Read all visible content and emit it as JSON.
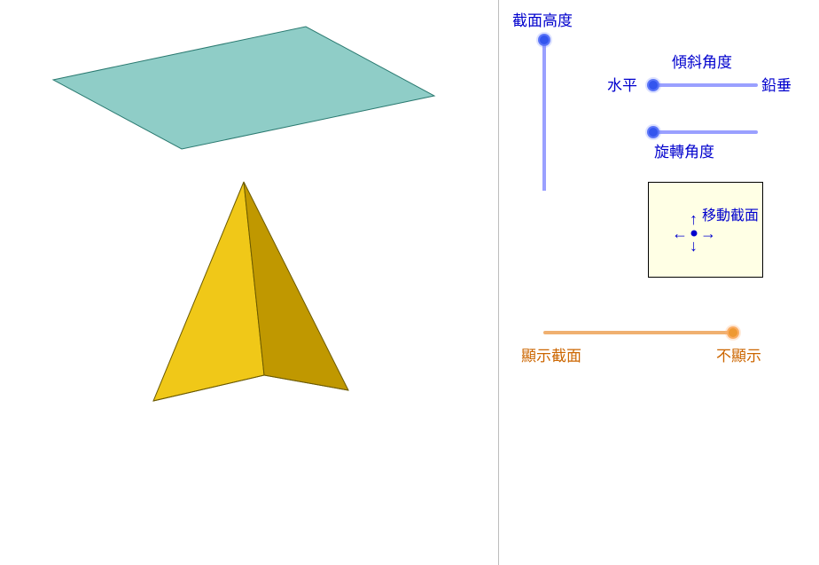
{
  "sliders": {
    "section_height": {
      "label": "截面高度"
    },
    "tilt_angle": {
      "label": "傾斜角度",
      "left": "水平",
      "right": "鉛垂"
    },
    "rotation_angle": {
      "label": "旋轉角度"
    }
  },
  "move_panel": {
    "label": "移動截面"
  },
  "display_toggle": {
    "left": "顯示截面",
    "right": "不顯示"
  },
  "chart_data": {
    "type": "diagram",
    "title": "Pyramid cross-section interactive",
    "objects": [
      {
        "name": "pyramid",
        "shape": "square_pyramid",
        "faces_visible": 2,
        "color": "#e0b800"
      },
      {
        "name": "cutting_plane",
        "shape": "quadrilateral",
        "color": "#7cc8c2",
        "position": "above_apex"
      }
    ],
    "controls": {
      "section_height": {
        "type": "vertical_slider",
        "value_position": "top"
      },
      "tilt_angle": {
        "type": "horizontal_slider",
        "value_position": "left",
        "endpoints": [
          "水平",
          "鉛垂"
        ]
      },
      "rotation_angle": {
        "type": "horizontal_slider",
        "value_position": "left"
      },
      "move_section": {
        "type": "2d_pad"
      },
      "display_toggle": {
        "type": "horizontal_slider",
        "value_position": "right",
        "endpoints": [
          "顯示截面",
          "不顯示"
        ]
      }
    }
  }
}
